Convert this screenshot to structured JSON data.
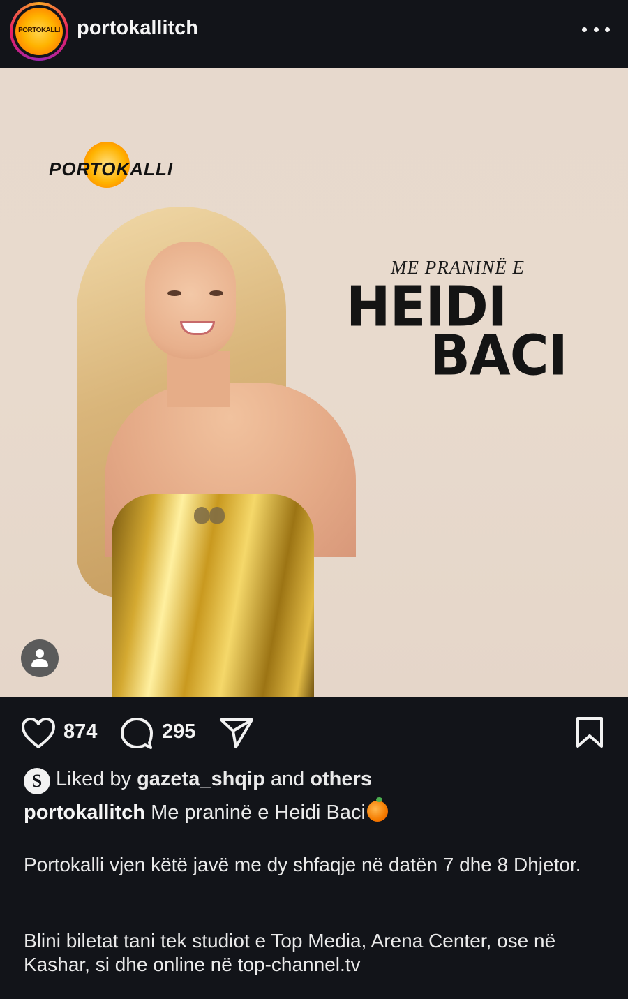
{
  "header": {
    "username": "portokallitch",
    "avatar_logo_text": "PORTOKALLI"
  },
  "post": {
    "brand_logo_text": "PORTOKALLI",
    "tagline": "ME PRANINË E",
    "name_line1": "HEIDI",
    "name_line2": "BACI"
  },
  "actions": {
    "likes": "874",
    "comments": "295"
  },
  "liked_by": {
    "avatar_letter": "S",
    "prefix": "Liked by",
    "user": "gazeta_shqip",
    "middle": "and",
    "suffix": "others"
  },
  "caption": {
    "username": "portokallitch",
    "text": "Me praninë e Heidi Baci",
    "paragraph1": "Portokalli vjen këtë javë me dy shfaqje në datën 7 dhe 8 Dhjetor.",
    "paragraph2": "Blini biletat tani tek studiot e Top Media, Arena Center, ose në Kashar, si dhe online në top-channel.tv"
  },
  "icons": {
    "more": "more-dots-icon",
    "like": "heart-icon",
    "comment": "comment-icon",
    "share": "send-icon",
    "save": "bookmark-icon",
    "user_tag": "user-tag-icon",
    "emoji": "orange-emoji"
  }
}
